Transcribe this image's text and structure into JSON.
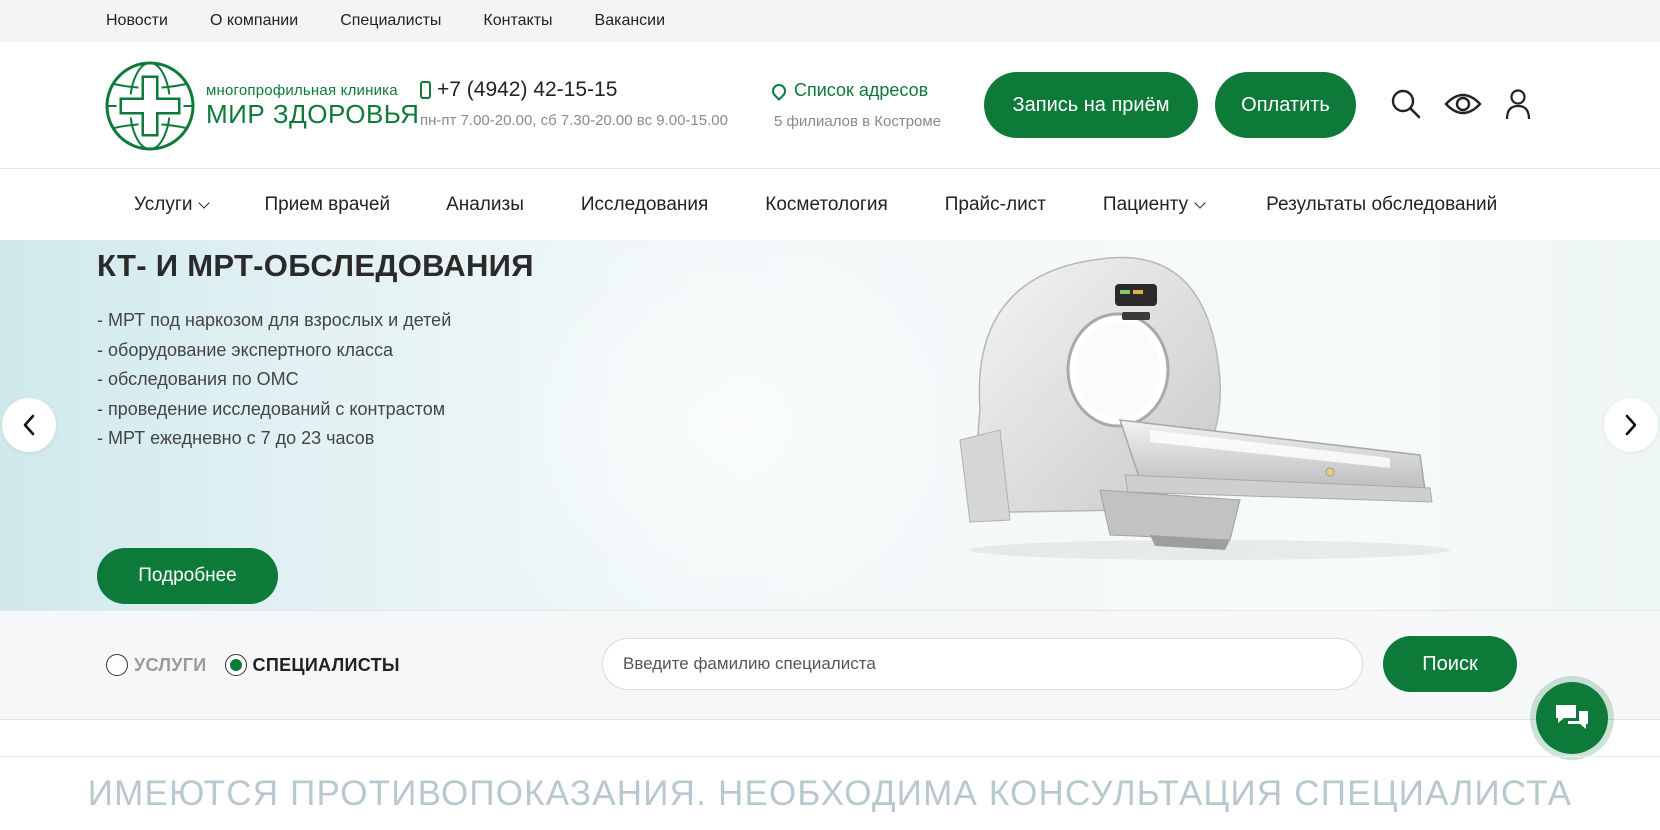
{
  "topbar": {
    "links": [
      "Новости",
      "О компании",
      "Специалисты",
      "Контакты",
      "Вакансии"
    ]
  },
  "header": {
    "logo_sub": "многопрофильная клиника",
    "logo_main": "МИР ЗДОРОВЬЯ",
    "phone": "+7 (4942) 42-15-15",
    "hours": "пн-пт 7.00-20.00, сб 7.30-20.00 вс 9.00-15.00",
    "address_link": "Список адресов",
    "branches": "5 филиалов в Костроме",
    "book_button": "Запись на приём",
    "pay_button": "Оплатить",
    "icons": [
      "search-icon",
      "eye-icon",
      "user-icon"
    ]
  },
  "nav": {
    "items": [
      {
        "label": "Услуги",
        "dropdown": true
      },
      {
        "label": "Прием врачей",
        "dropdown": false
      },
      {
        "label": "Анализы",
        "dropdown": false
      },
      {
        "label": "Исследования",
        "dropdown": false
      },
      {
        "label": "Косметология",
        "dropdown": false
      },
      {
        "label": "Прайс-лист",
        "dropdown": false
      },
      {
        "label": "Пациенту",
        "dropdown": true
      },
      {
        "label": "Результаты обследований",
        "dropdown": false
      }
    ]
  },
  "hero": {
    "title": "КТ- И МРТ-ОБСЛЕДОВАНИЯ",
    "bullets": [
      "- МРТ под наркозом для взрослых и детей",
      "- оборудование экспертного класса",
      "- обследования по ОМС",
      "- проведение исследований с контрастом",
      "- МРТ ежедневно с 7 до 23 часов"
    ],
    "more_button": "Подробнее"
  },
  "search": {
    "radio_services": "УСЛУГИ",
    "radio_specialists": "СПЕЦИАЛИСТЫ",
    "selected": "СПЕЦИАЛИСТЫ",
    "placeholder": "Введите фамилию специалиста",
    "value": "",
    "button": "Поиск"
  },
  "warning": "ИМЕЮТСЯ ПРОТИВОПОКАЗАНИЯ. НЕОБХОДИМА КОНСУЛЬТАЦИЯ СПЕЦИАЛИСТА",
  "colors": {
    "brand_green": "#0e7a3a",
    "topbar_bg": "#f3f4f5",
    "warning_text": "#b7c9cf"
  }
}
